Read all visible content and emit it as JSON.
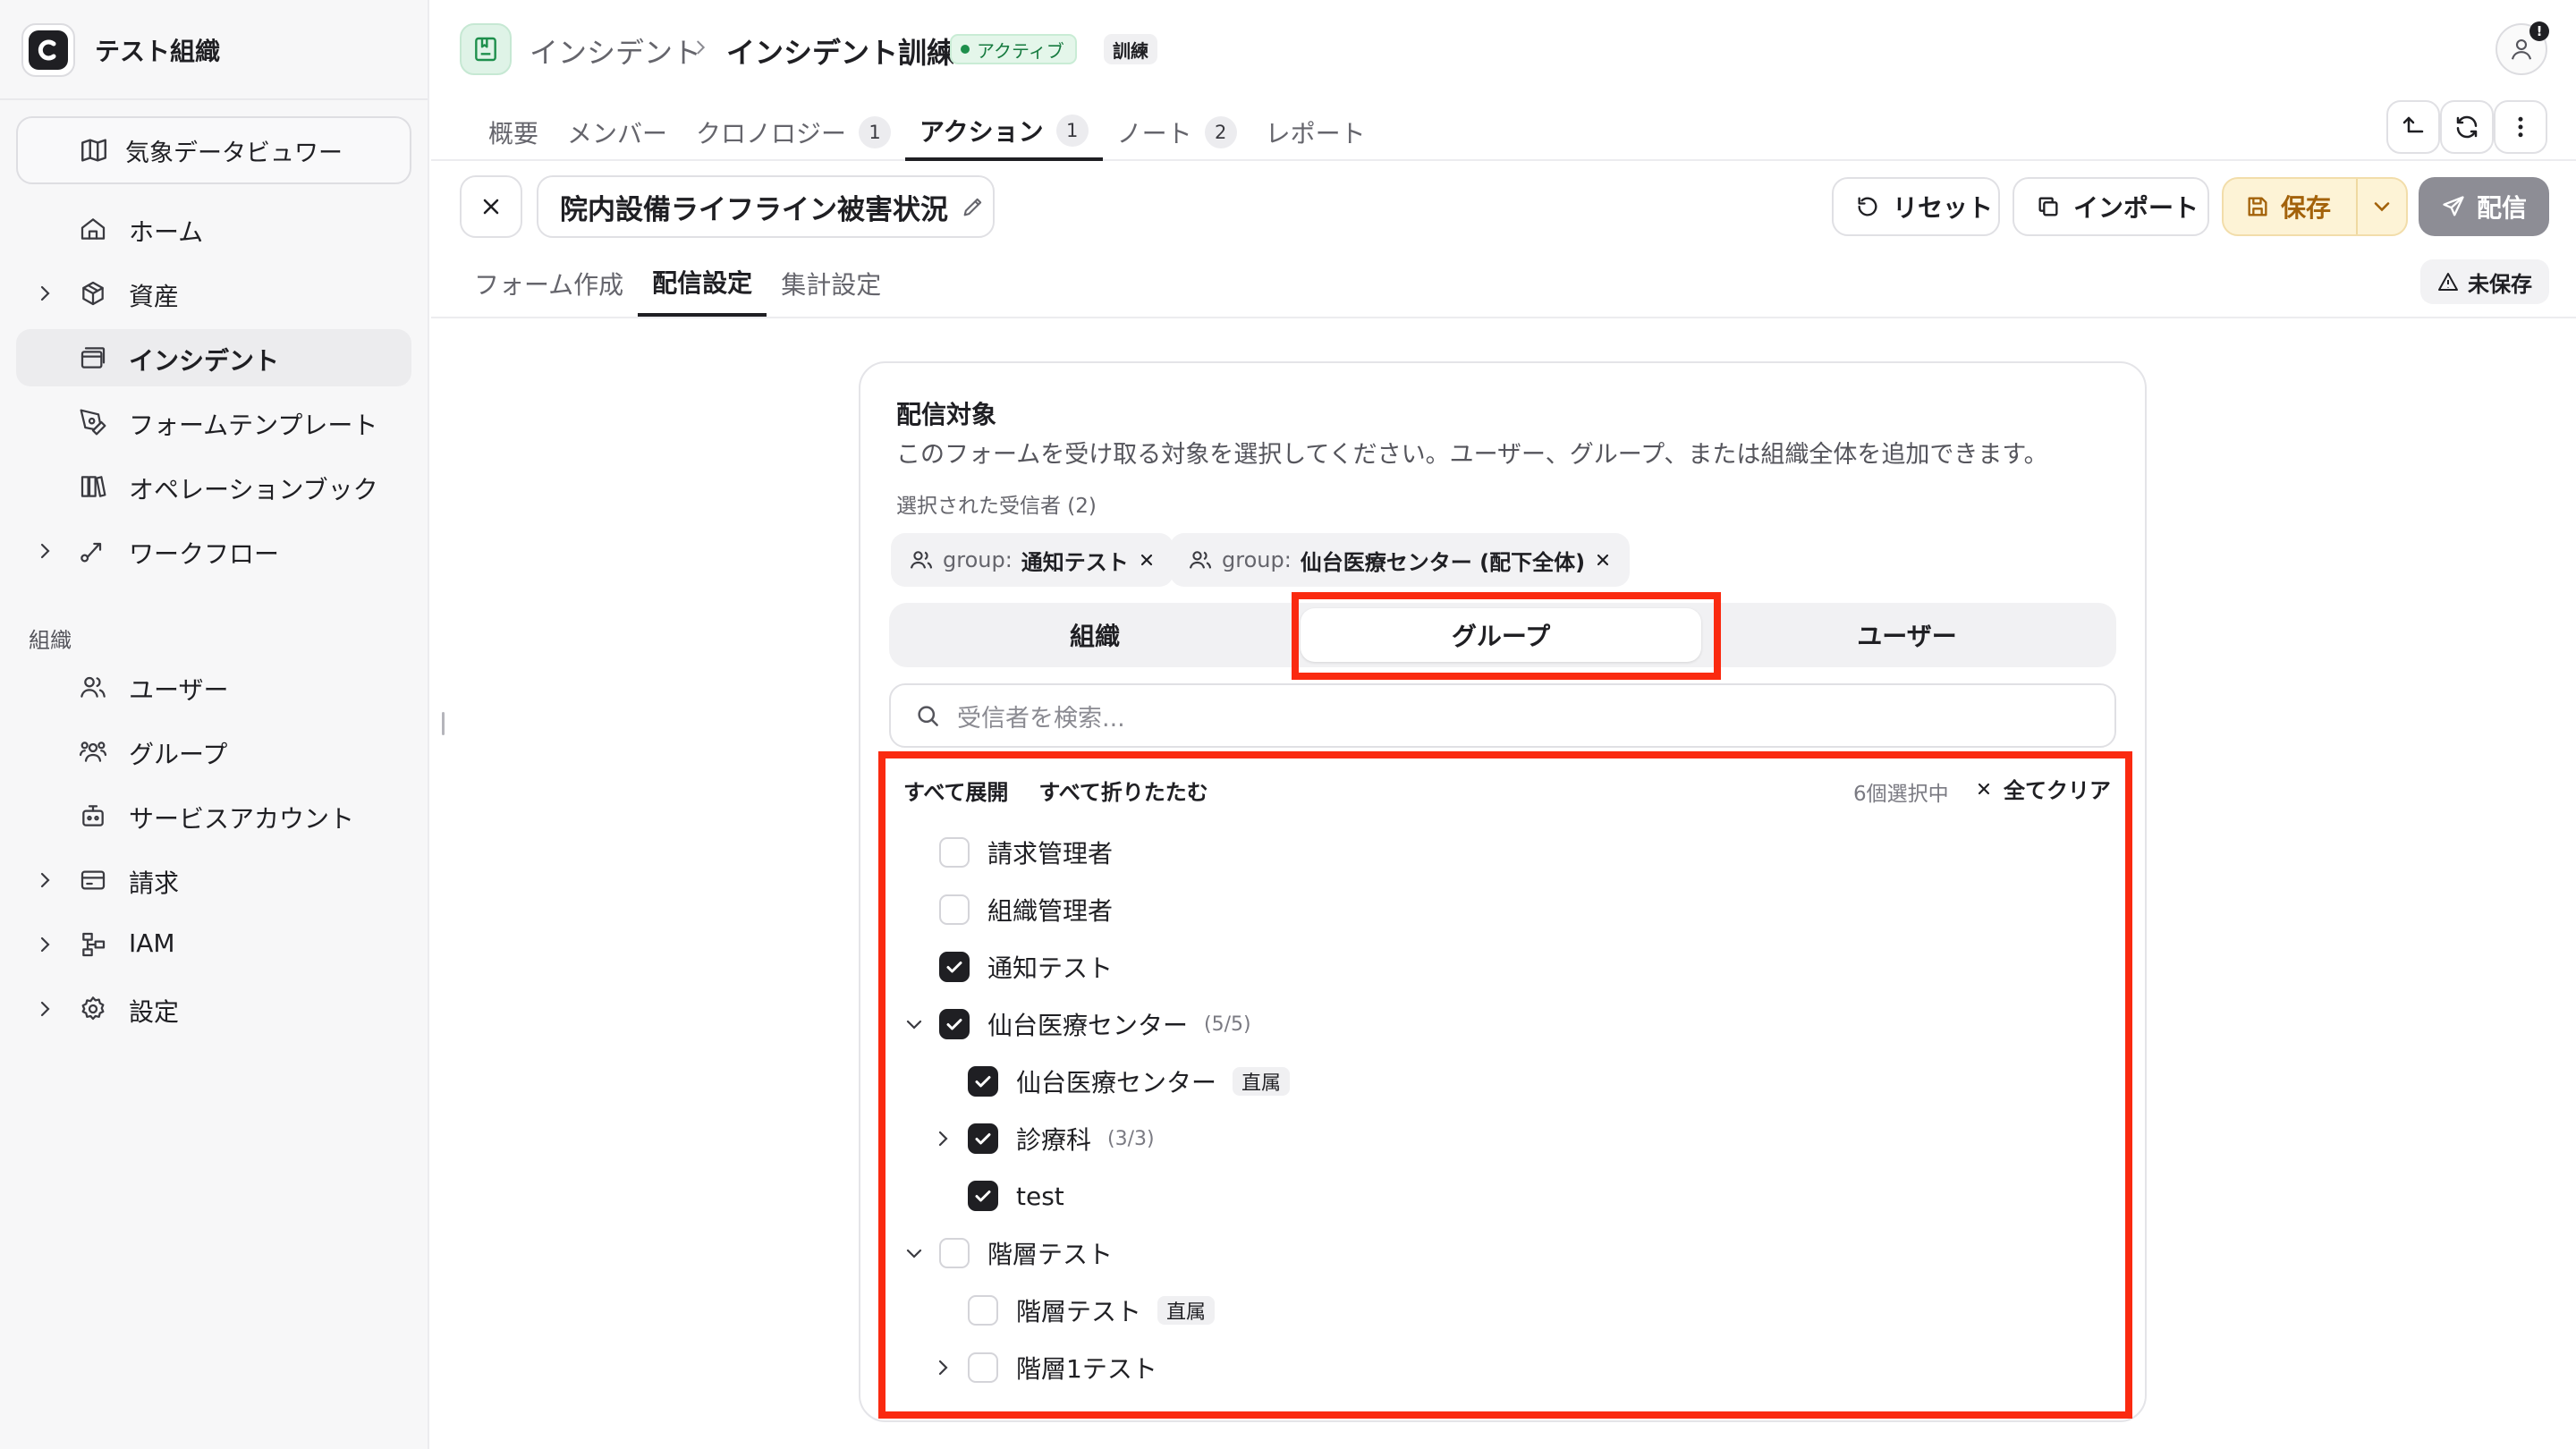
{
  "sidebar": {
    "org_name": "テスト組織",
    "weather_label": "気象データビュワー",
    "items": [
      {
        "label": "ホーム",
        "icon": "home-icon",
        "chevron": false,
        "active": false
      },
      {
        "label": "資産",
        "icon": "box-icon",
        "chevron": true,
        "active": false
      },
      {
        "label": "インシデント",
        "icon": "cards-icon",
        "chevron": false,
        "active": true
      },
      {
        "label": "フォームテンプレート",
        "icon": "pen-tool-icon",
        "chevron": false,
        "active": false
      },
      {
        "label": "オペレーションブック",
        "icon": "book-icon",
        "chevron": false,
        "active": false
      },
      {
        "label": "ワークフロー",
        "icon": "workflow-icon",
        "chevron": true,
        "active": false
      }
    ],
    "section_org": "組織",
    "org_items": [
      {
        "label": "ユーザー",
        "icon": "users-icon",
        "chevron": false
      },
      {
        "label": "グループ",
        "icon": "group-icon",
        "chevron": false
      },
      {
        "label": "サービスアカウント",
        "icon": "bot-icon",
        "chevron": false
      },
      {
        "label": "請求",
        "icon": "wallet-icon",
        "chevron": true
      },
      {
        "label": "IAM",
        "icon": "network-icon",
        "chevron": true
      },
      {
        "label": "設定",
        "icon": "gear-icon",
        "chevron": true
      }
    ]
  },
  "header": {
    "breadcrumb_parent": "インシデント",
    "breadcrumb_current": "インシデント訓練",
    "status_badge": "アクティブ",
    "type_badge": "訓練",
    "user_alert": "!"
  },
  "tabs": [
    {
      "label": "概要",
      "count": null,
      "active": false
    },
    {
      "label": "メンバー",
      "count": null,
      "active": false
    },
    {
      "label": "クロノロジー",
      "count": "1",
      "active": false
    },
    {
      "label": "アクション",
      "count": "1",
      "active": true
    },
    {
      "label": "ノート",
      "count": "2",
      "active": false
    },
    {
      "label": "レポート",
      "count": null,
      "active": false
    }
  ],
  "form": {
    "title": "院内設備ライフライン被害状況",
    "reset_label": "リセット",
    "import_label": "インポート",
    "save_label": "保存",
    "send_label": "配信",
    "subtabs": [
      "フォーム作成",
      "配信設定",
      "集計設定"
    ],
    "active_subtab": 1,
    "unsaved_label": "未保存"
  },
  "delivery": {
    "title": "配信対象",
    "description": "このフォームを受け取る対象を選択してください。ユーザー、グループ、または組織全体を追加できます。",
    "selected_label": "選択された受信者 (2)",
    "chips": [
      {
        "prefix": "group:",
        "name": "通知テスト"
      },
      {
        "prefix": "group:",
        "name": "仙台医療センター (配下全体)"
      }
    ],
    "segments": [
      "組織",
      "グループ",
      "ユーザー"
    ],
    "active_segment": 1,
    "search_placeholder": "受信者を検索...",
    "expand_all": "すべて展開",
    "collapse_all": "すべて折りたたむ",
    "selected_count": "6個選択中",
    "clear_all": "全てクリア",
    "tree": [
      {
        "label": "請求管理者",
        "checked": false,
        "level": 0,
        "expander": "none",
        "count": "",
        "tag": ""
      },
      {
        "label": "組織管理者",
        "checked": false,
        "level": 0,
        "expander": "none",
        "count": "",
        "tag": ""
      },
      {
        "label": "通知テスト",
        "checked": true,
        "level": 0,
        "expander": "none",
        "count": "",
        "tag": ""
      },
      {
        "label": "仙台医療センター",
        "checked": true,
        "level": 0,
        "expander": "open",
        "count": "(5/5)",
        "tag": ""
      },
      {
        "label": "仙台医療センター",
        "checked": true,
        "level": 1,
        "expander": "none",
        "count": "",
        "tag": "直属"
      },
      {
        "label": "診療科",
        "checked": true,
        "level": 1,
        "expander": "closed",
        "count": "(3/3)",
        "tag": ""
      },
      {
        "label": "test",
        "checked": true,
        "level": 1,
        "expander": "none",
        "count": "",
        "tag": ""
      },
      {
        "label": "階層テスト",
        "checked": false,
        "level": 0,
        "expander": "open",
        "count": "",
        "tag": ""
      },
      {
        "label": "階層テスト",
        "checked": false,
        "level": 1,
        "expander": "none",
        "count": "",
        "tag": "直属"
      },
      {
        "label": "階層1テスト",
        "checked": false,
        "level": 1,
        "expander": "closed",
        "count": "",
        "tag": ""
      }
    ]
  },
  "colors": {
    "highlight": "#fa2a10",
    "accent_dark": "#1f1f23",
    "save_text": "#a3620a",
    "status_green": "#167a3f"
  }
}
